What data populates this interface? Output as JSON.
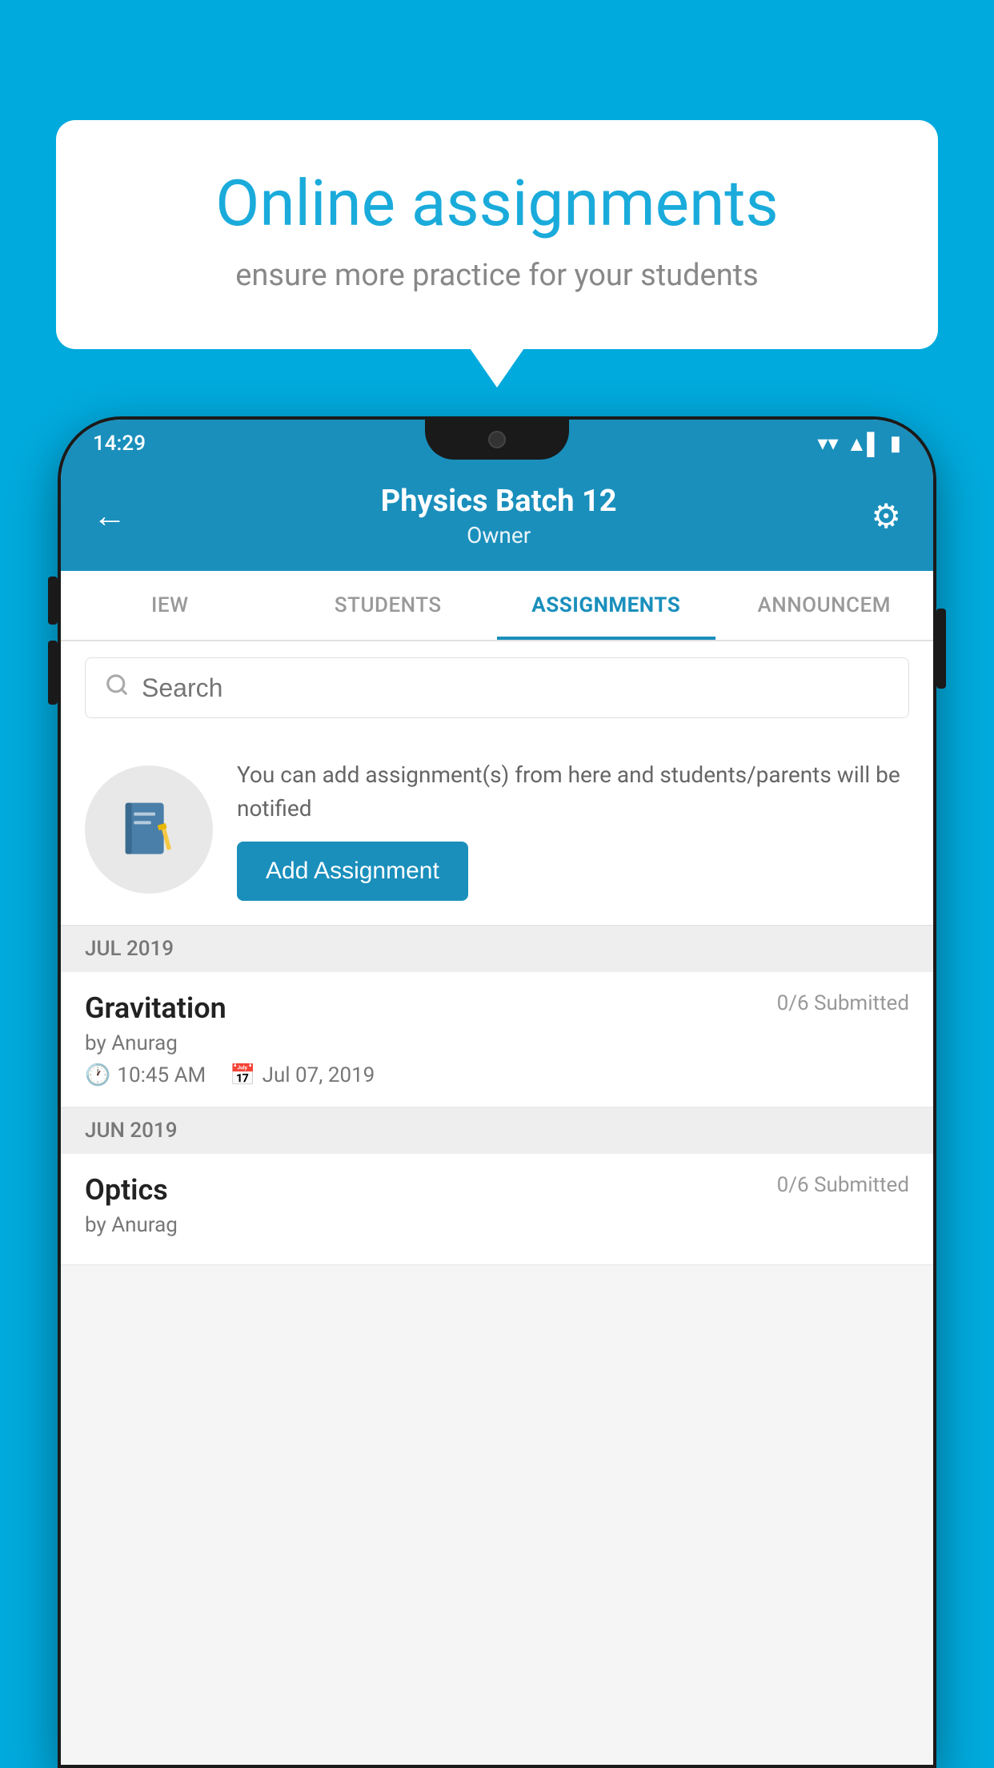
{
  "background_color": "#00AADD",
  "speech_bubble": {
    "title": "Online assignments",
    "subtitle": "ensure more practice for your students"
  },
  "phone": {
    "status_bar": {
      "time": "14:29",
      "wifi": "▾",
      "signal": "▲",
      "battery": "▮"
    },
    "header": {
      "back_label": "←",
      "title": "Physics Batch 12",
      "subtitle": "Owner",
      "settings_label": "⚙"
    },
    "tabs": [
      {
        "label": "IEW",
        "active": false
      },
      {
        "label": "STUDENTS",
        "active": false
      },
      {
        "label": "ASSIGNMENTS",
        "active": true
      },
      {
        "label": "ANNOUNCEM",
        "active": false
      }
    ],
    "search": {
      "placeholder": "Search"
    },
    "promo": {
      "icon": "📓",
      "text": "You can add assignment(s) from here and students/parents will be notified",
      "button_label": "Add Assignment"
    },
    "assignments": [
      {
        "month_label": "JUL 2019",
        "items": [
          {
            "title": "Gravitation",
            "submitted": "0/6 Submitted",
            "author": "by Anurag",
            "time": "10:45 AM",
            "date": "Jul 07, 2019"
          }
        ]
      },
      {
        "month_label": "JUN 2019",
        "items": [
          {
            "title": "Optics",
            "submitted": "0/6 Submitted",
            "author": "by Anurag",
            "time": "",
            "date": ""
          }
        ]
      }
    ]
  }
}
